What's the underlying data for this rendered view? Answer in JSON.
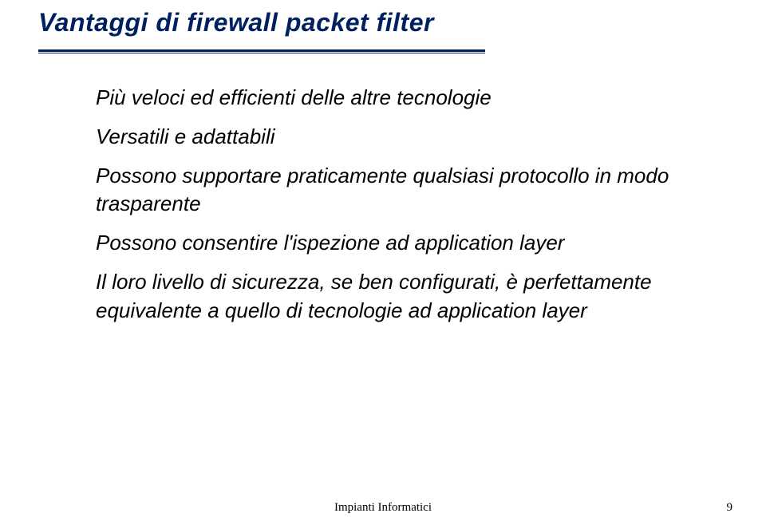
{
  "slide": {
    "title": "Vantaggi di firewall packet filter",
    "bullets": [
      "Più veloci ed efficienti delle altre tecnologie",
      "Versatili e adattabili",
      "Possono supportare praticamente qualsiasi protocollo in modo trasparente",
      "Possono consentire l'ispezione ad application layer",
      "Il loro livello di sicurezza, se ben configurati, è perfettamente equivalente a quello di tecnologie ad application layer"
    ],
    "footer": "Impianti Informatici",
    "page_number": "9"
  }
}
